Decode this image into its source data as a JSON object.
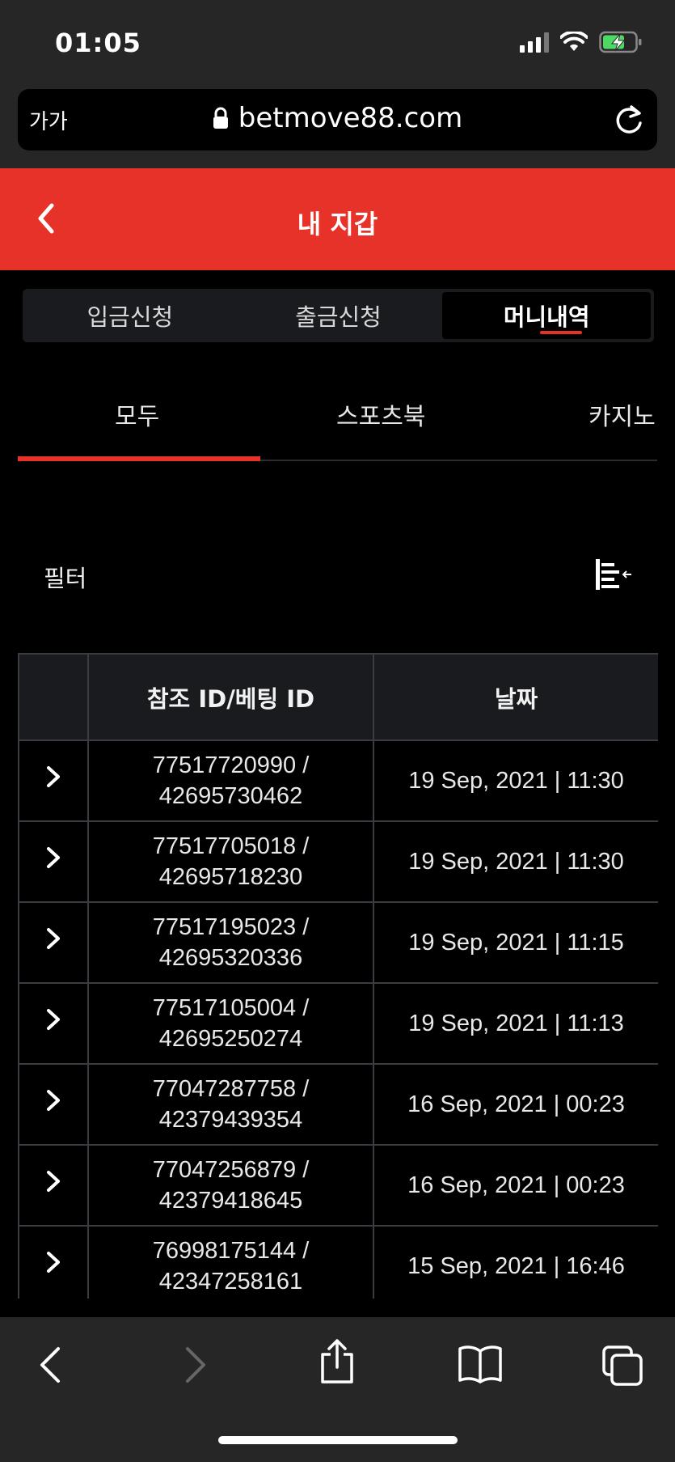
{
  "status_bar": {
    "time": "01:05"
  },
  "browser": {
    "text_size_label": "가가",
    "url": "betmove88.com"
  },
  "header": {
    "title": "내 지갑"
  },
  "wallet_tabs": [
    {
      "label": "입금신청",
      "active": false
    },
    {
      "label": "출금신청",
      "active": false
    },
    {
      "label": "머니내역",
      "active": true
    }
  ],
  "category_tabs": [
    {
      "label": "모두",
      "active": true
    },
    {
      "label": "스포츠북",
      "active": false
    },
    {
      "label": "카지노",
      "active": false
    }
  ],
  "filter": {
    "label": "필터"
  },
  "table": {
    "headers": [
      "",
      "참조 ID/베팅 ID",
      "날짜"
    ],
    "rows": [
      {
        "ref_id": "77517720990 /",
        "bet_id": "42695730462",
        "date": "19 Sep, 2021 | 11:30"
      },
      {
        "ref_id": "77517705018 /",
        "bet_id": "42695718230",
        "date": "19 Sep, 2021 | 11:30"
      },
      {
        "ref_id": "77517195023 /",
        "bet_id": "42695320336",
        "date": "19 Sep, 2021 | 11:15"
      },
      {
        "ref_id": "77517105004 /",
        "bet_id": "42695250274",
        "date": "19 Sep, 2021 | 11:13"
      },
      {
        "ref_id": "77047287758 /",
        "bet_id": "42379439354",
        "date": "16 Sep, 2021 | 00:23"
      },
      {
        "ref_id": "77047256879 /",
        "bet_id": "42379418645",
        "date": "16 Sep, 2021 | 00:23"
      },
      {
        "ref_id": "76998175144 /",
        "bet_id": "42347258161",
        "date": "15 Sep, 2021 | 16:46"
      },
      {
        "ref_id": "",
        "bet_id": "",
        "date": ""
      }
    ]
  },
  "colors": {
    "accent": "#e63228",
    "background": "#000000",
    "chrome": "#262626"
  },
  "icons": {
    "battery": "battery-charging-icon",
    "wifi": "wifi-icon",
    "signal": "cellular-signal-icon",
    "lock": "lock-icon",
    "reload": "reload-icon",
    "back": "chevron-left-icon",
    "filter": "filter-lines-icon",
    "row_expand": "chevron-right-icon"
  }
}
